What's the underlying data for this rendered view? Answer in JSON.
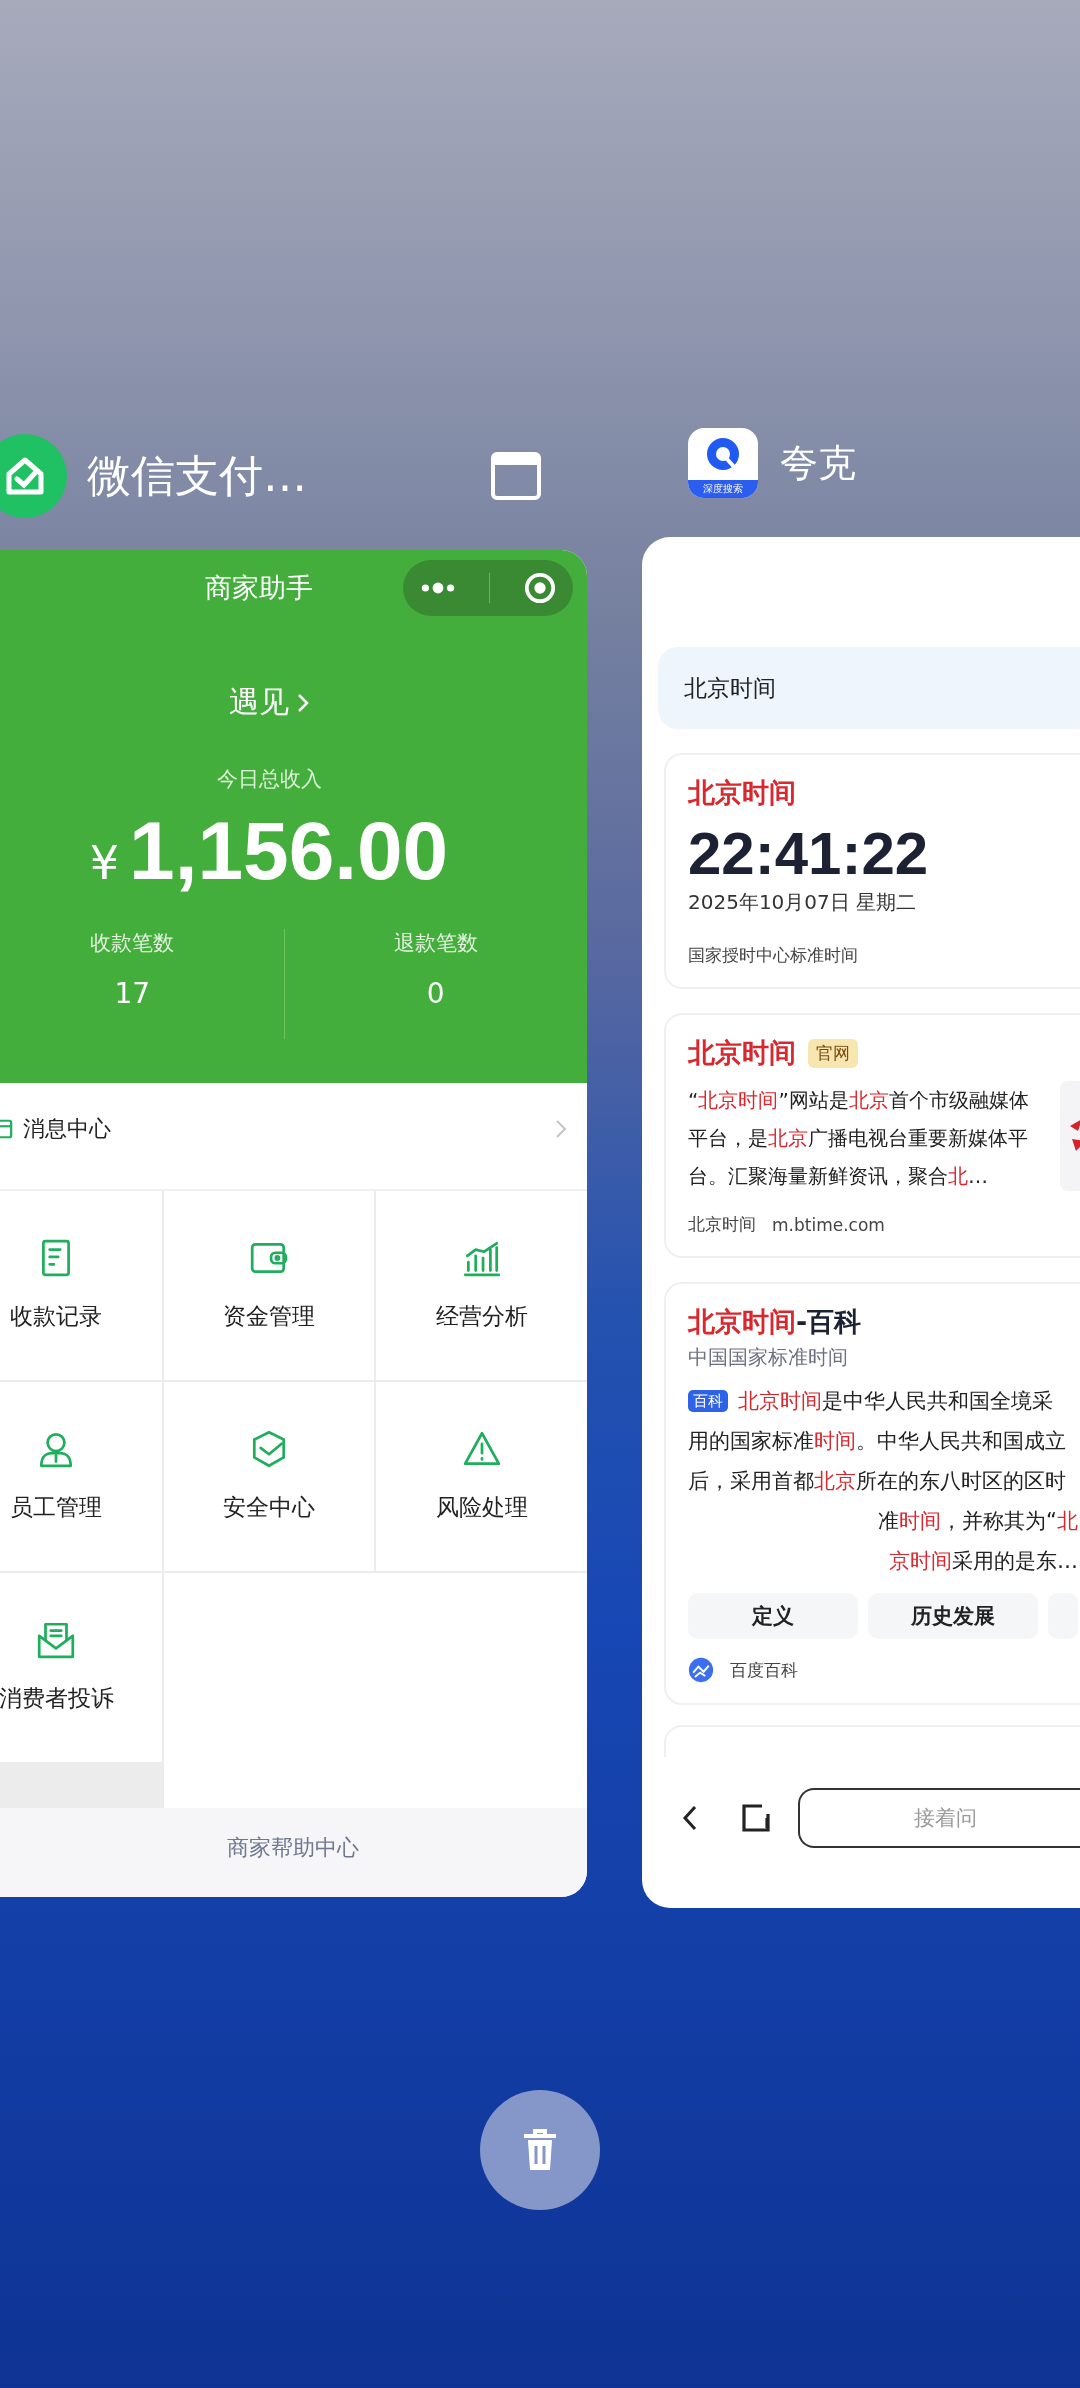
{
  "left_app": {
    "name": "微信支付…",
    "mini_program": {
      "title": "商家助手",
      "store_name": "遇见",
      "income_label": "今日总收入",
      "currency": "¥",
      "income": "1,156.00",
      "stats": [
        {
          "label": "收款笔数",
          "value": "17"
        },
        {
          "label": "退款笔数",
          "value": "0"
        }
      ],
      "message_center": "消息中心",
      "menu": [
        {
          "label": "收款记录",
          "kind": "receipt"
        },
        {
          "label": "资金管理",
          "kind": "wallet"
        },
        {
          "label": "经营分析",
          "kind": "chart"
        },
        {
          "label": "员工管理",
          "kind": "staff"
        },
        {
          "label": "安全中心",
          "kind": "shield"
        },
        {
          "label": "风险处理",
          "kind": "warning"
        },
        {
          "label": "消费者投诉",
          "kind": "mail"
        }
      ],
      "footer_link": "商家帮助中心"
    }
  },
  "right_app": {
    "name": "夸克",
    "icon_badge": "深度搜索",
    "query": "北京时间",
    "time_card": {
      "title": "北京时间",
      "time": "22:41:22",
      "date": "2025年10月07日 星期二",
      "source": "国家授时中心标准时间"
    },
    "site_card": {
      "title": "北京时间",
      "badge": "官网",
      "snippet": [
        {
          "text": "“",
          "highlight": false
        },
        {
          "text": "北京时间",
          "highlight": true
        },
        {
          "text": "”网站是",
          "highlight": false
        },
        {
          "text": "北京",
          "highlight": true
        },
        {
          "text": "首个市级融媒体平台，是",
          "highlight": false
        },
        {
          "text": "北京",
          "highlight": true
        },
        {
          "text": "广播电视台重要新媒体平台。汇聚海量新鲜资讯，聚合",
          "highlight": false
        },
        {
          "text": "北",
          "highlight": true
        },
        {
          "text": "…",
          "highlight": false
        }
      ],
      "source_name": "北京时间",
      "url": "m.btime.com"
    },
    "wiki_card": {
      "title": [
        {
          "text": "北京时间",
          "highlight": true
        },
        {
          "text": "-百科",
          "highlight": false
        }
      ],
      "subtitle": "中国国家标准时间",
      "badge": "百科",
      "snippet_first": [
        {
          "text": "北京时间",
          "highlight": true
        },
        {
          "text": "是中华人民共和国全境采",
          "highlight": false
        }
      ],
      "snippet": [
        {
          "text": "用的国家标准",
          "highlight": false
        },
        {
          "text": "时间",
          "highlight": true
        },
        {
          "text": "。中华人民共和国成立后，采用首都",
          "highlight": false
        },
        {
          "text": "北京",
          "highlight": true
        },
        {
          "text": "所在的东八时区的区时",
          "highlight": false
        }
      ],
      "snippet_tail": [
        [
          {
            "text": "准",
            "highlight": false
          },
          {
            "text": "时间",
            "highlight": true
          },
          {
            "text": "，并称其为“",
            "highlight": false
          },
          {
            "text": "北",
            "highlight": true
          }
        ],
        [
          {
            "text": "京时间",
            "highlight": true
          },
          {
            "text": "采用的是东…",
            "highlight": false
          }
        ]
      ],
      "chips": [
        "定义",
        "历史发展"
      ],
      "source": "百度百科"
    },
    "bottom_bar": {
      "placeholder": "接着问"
    }
  }
}
